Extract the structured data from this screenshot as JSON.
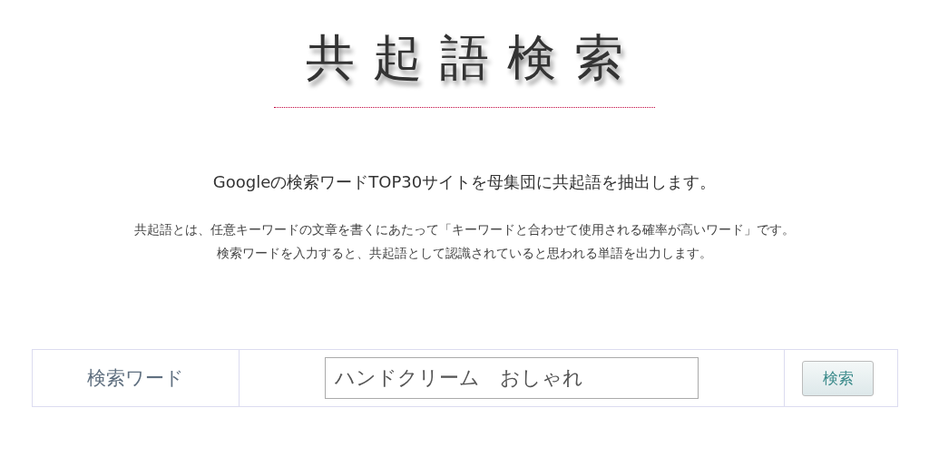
{
  "logo": {
    "title": "共起語検索"
  },
  "lead": "Googleの検索ワードTOP30サイトを母集団に共起語を抽出します。",
  "description": [
    "共起語とは、任意キーワードの文章を書くにあたって「キーワードと合わせて使用される確率が高いワード」です。",
    "検索ワードを入力すると、共起語として認識されていると思われる単語を出力します。"
  ],
  "search": {
    "label": "検索ワード",
    "value": "ハンドクリーム　おしゃれ",
    "button": "検索"
  }
}
